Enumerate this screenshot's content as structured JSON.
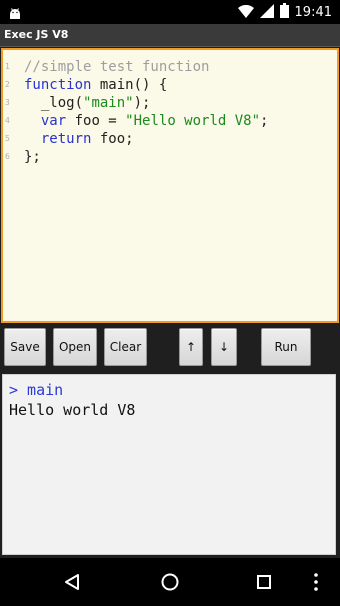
{
  "status_bar": {
    "time": "19:41",
    "icons": [
      "android-icon",
      "wifi-icon",
      "signal-icon",
      "battery-icon"
    ]
  },
  "app": {
    "title": "Exec JS V8"
  },
  "editor": {
    "line_numbers": [
      "1",
      "2",
      "3",
      "4",
      "5",
      "6"
    ],
    "lines": [
      [
        {
          "t": "comment",
          "v": "//simple test function"
        }
      ],
      [
        {
          "t": "keyword",
          "v": "function"
        },
        {
          "t": "plain",
          "v": " main() {"
        }
      ],
      [
        {
          "t": "plain",
          "v": "  _log("
        },
        {
          "t": "string",
          "v": "\"main\""
        },
        {
          "t": "plain",
          "v": ");"
        }
      ],
      [
        {
          "t": "plain",
          "v": "  "
        },
        {
          "t": "keyword",
          "v": "var"
        },
        {
          "t": "plain",
          "v": " foo = "
        },
        {
          "t": "string",
          "v": "\"Hello world V8\""
        },
        {
          "t": "plain",
          "v": ";"
        }
      ],
      [
        {
          "t": "plain",
          "v": "  "
        },
        {
          "t": "keyword",
          "v": "return"
        },
        {
          "t": "plain",
          "v": " foo;"
        }
      ],
      [
        {
          "t": "plain",
          "v": "};"
        }
      ]
    ],
    "border_color": "#f39a22"
  },
  "toolbar": {
    "save": "Save",
    "open": "Open",
    "clear": "Clear",
    "up": "↑",
    "down": "↓",
    "run": "Run"
  },
  "console": {
    "prompt": "> main",
    "output": "Hello world V8"
  },
  "nav_bar": {
    "icons": [
      "back-icon",
      "home-icon",
      "recents-icon",
      "overflow-menu-icon"
    ]
  }
}
